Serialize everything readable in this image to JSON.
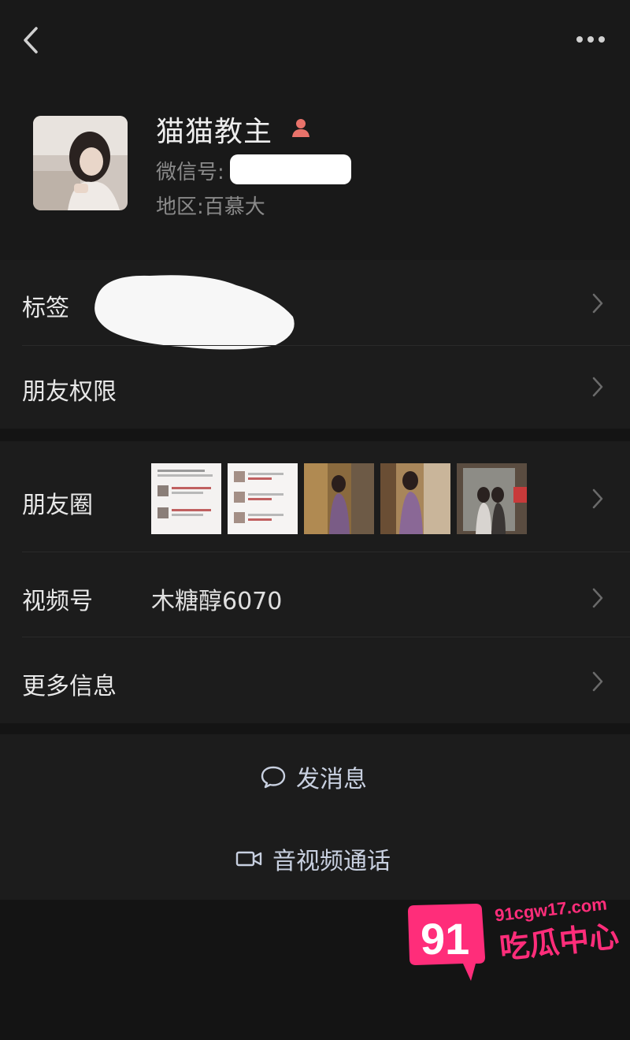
{
  "header": {
    "back_icon": "chevron-left-icon",
    "more_icon": "more-horizontal-icon"
  },
  "profile": {
    "nickname": "猫猫教主",
    "gender_icon": "female-person-icon",
    "wxid_label": "微信号:",
    "region": "地区:百慕大"
  },
  "rows": {
    "tags_label": "标签",
    "friend_permissions_label": "朋友权限",
    "moments_label": "朋友圈",
    "channels_label": "视频号",
    "channels_value": "木糖醇6070",
    "more_info_label": "更多信息"
  },
  "actions": {
    "send_message": "发消息",
    "av_call": "音视频通话"
  },
  "watermark": {
    "number": "91",
    "url": "91cgw17.com",
    "text": "吃瓜中心"
  },
  "colors": {
    "background": "#141414",
    "card": "#1c1c1c",
    "accent_link": "#c8d0e0",
    "watermark_pink": "#ff2d7a"
  }
}
